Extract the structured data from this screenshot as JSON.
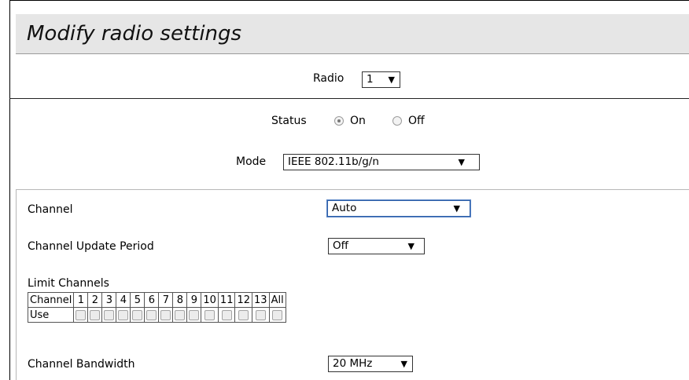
{
  "header": {
    "title": "Modify radio settings"
  },
  "radio": {
    "label": "Radio",
    "value": "1"
  },
  "status": {
    "label": "Status",
    "on_label": "On",
    "off_label": "Off",
    "selected": "On"
  },
  "mode": {
    "label": "Mode",
    "value": "IEEE 802.11b/g/n"
  },
  "channel": {
    "label": "Channel",
    "value": "Auto"
  },
  "channel_update": {
    "label": "Channel Update Period",
    "value": "Off"
  },
  "limit_channels": {
    "label": "Limit Channels",
    "row_header_channel": "Channel",
    "row_header_use": "Use",
    "channels": [
      "1",
      "2",
      "3",
      "4",
      "5",
      "6",
      "7",
      "8",
      "9",
      "10",
      "11",
      "12",
      "13",
      "All"
    ]
  },
  "bandwidth": {
    "label": "Channel Bandwidth",
    "value": "20 MHz"
  },
  "icons": {
    "dropdown": "dropdown-arrow-icon"
  }
}
